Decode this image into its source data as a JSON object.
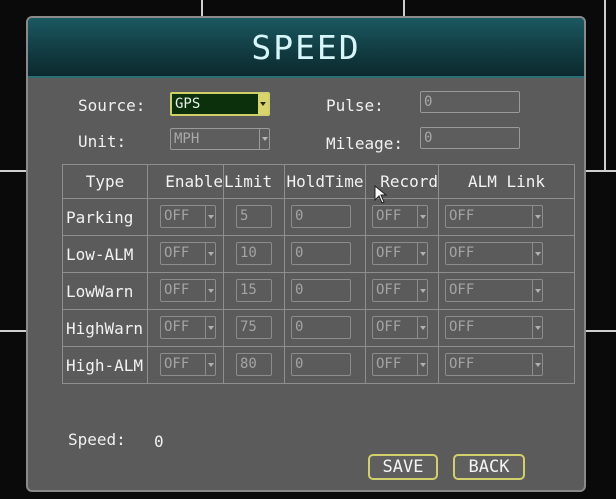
{
  "title": "SPEED",
  "source": {
    "label": "Source:",
    "value": "GPS"
  },
  "unit": {
    "label": "Unit:",
    "value": "MPH"
  },
  "pulse": {
    "label": "Pulse:",
    "value": "0"
  },
  "mileage": {
    "label": "Mileage:",
    "value": "0"
  },
  "table": {
    "headers": [
      "Type",
      "Enable",
      "Limit",
      "HoldTime",
      "Record",
      "ALM Link"
    ],
    "rows": [
      {
        "type": "Parking",
        "enable": "OFF",
        "limit": "5",
        "hold": "0",
        "record": "OFF",
        "alm": "OFF"
      },
      {
        "type": "Low-ALM",
        "enable": "OFF",
        "limit": "10",
        "hold": "0",
        "record": "OFF",
        "alm": "OFF"
      },
      {
        "type": "LowWarn",
        "enable": "OFF",
        "limit": "15",
        "hold": "0",
        "record": "OFF",
        "alm": "OFF"
      },
      {
        "type": "HighWarn",
        "enable": "OFF",
        "limit": "75",
        "hold": "0",
        "record": "OFF",
        "alm": "OFF"
      },
      {
        "type": "High-ALM",
        "enable": "OFF",
        "limit": "80",
        "hold": "0",
        "record": "OFF",
        "alm": "OFF"
      }
    ]
  },
  "speed": {
    "label": "Speed:",
    "value": "0"
  },
  "buttons": {
    "save": "SAVE",
    "back": "BACK"
  },
  "colors": {
    "title_bar": "#113a40",
    "panel": "#5b5b5b",
    "highlight": "#d1d06a"
  }
}
